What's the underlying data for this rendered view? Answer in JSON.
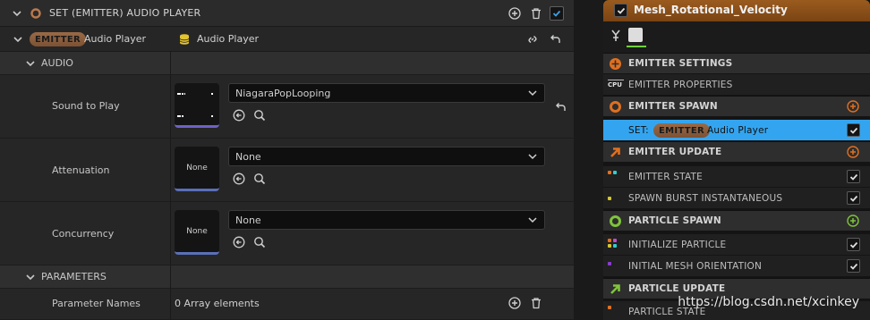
{
  "details": {
    "header": {
      "title": "SET (EMITTER) AUDIO PLAYER"
    },
    "emitter_row": {
      "badge": "EMITTER",
      "label": "Audio Player",
      "value": "Audio Player"
    },
    "audio_category": {
      "label": "AUDIO"
    },
    "properties": [
      {
        "label": "Sound to Play",
        "value": "NiagaraPopLooping",
        "thumb": ""
      },
      {
        "label": "Attenuation",
        "value": "None",
        "thumb": "None"
      },
      {
        "label": "Concurrency",
        "value": "None",
        "thumb": "None"
      }
    ],
    "parameters_category": {
      "label": "PARAMETERS"
    },
    "parameter_names": {
      "label": "Parameter Names",
      "value": "0 Array elements"
    }
  },
  "node": {
    "title": "Mesh_Rotational_Velocity",
    "sections": {
      "emitter_settings": "EMITTER SETTINGS",
      "emitter_spawn": "EMITTER SPAWN",
      "emitter_update": "EMITTER UPDATE",
      "particle_spawn": "PARTICLE SPAWN",
      "particle_update": "PARTICLE UPDATE"
    },
    "items": {
      "emitter_properties": "EMITTER PROPERTIES",
      "set_prefix": "SET:",
      "set_badge": "EMITTER",
      "set_label": "Audio Player",
      "emitter_state": "EMITTER STATE",
      "spawn_burst": "SPAWN BURST INSTANTANEOUS",
      "initialize_particle": "INITIALIZE PARTICLE",
      "initial_mesh_orientation": "INITIAL MESH ORIENTATION",
      "particle_state": "PARTICLE STATE"
    },
    "cpu_label": "CPU"
  },
  "watermark": "https://blog.csdn.net/xcinkey",
  "colors": {
    "accent_blue": "#33a5f0",
    "emitter_orange": "#e0701f",
    "particle_green": "#7fc43a",
    "badge_brown": "#8a5c3c"
  }
}
